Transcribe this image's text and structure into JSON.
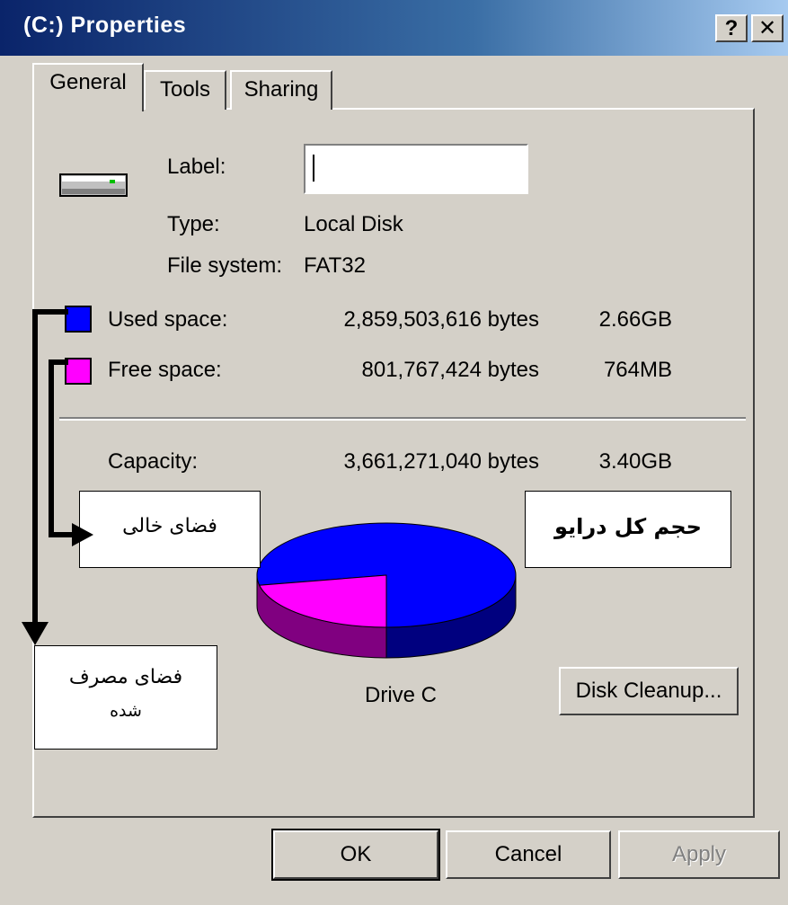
{
  "window": {
    "title": "(C:) Properties",
    "help_button": "?",
    "close_button": "✕"
  },
  "tabs": [
    {
      "label": "General",
      "active": true
    },
    {
      "label": "Tools",
      "active": false
    },
    {
      "label": "Sharing",
      "active": false
    }
  ],
  "general": {
    "drive_icon": "hard-drive-icon",
    "label_caption": "Label:",
    "label_value": "",
    "type_caption": "Type:",
    "type_value": "Local Disk",
    "filesystem_caption": "File system:",
    "filesystem_value": "FAT32",
    "used": {
      "caption": "Used space:",
      "bytes": "2,859,503,616 bytes",
      "size": "2.66GB",
      "color": "#0000ff"
    },
    "free": {
      "caption": "Free space:",
      "bytes": "801,767,424 bytes",
      "size": "764MB",
      "color": "#ff00ff"
    },
    "capacity": {
      "caption": "Capacity:",
      "bytes": "3,661,271,040 bytes",
      "size": "3.40GB"
    },
    "drive_label": "Drive C",
    "disk_cleanup_label": "Disk Cleanup..."
  },
  "chart_data": {
    "type": "pie",
    "values": [
      2859503616,
      801767424
    ],
    "colors": [
      "#0000ff",
      "#ff00ff"
    ]
  },
  "annotations": {
    "free_space": "فضای خالی",
    "total_size": "حجم کل درایو",
    "used_space_line1": "فضای مصرف",
    "used_space_line2": "شده"
  },
  "buttons": {
    "ok": "OK",
    "cancel": "Cancel",
    "apply": "Apply"
  }
}
